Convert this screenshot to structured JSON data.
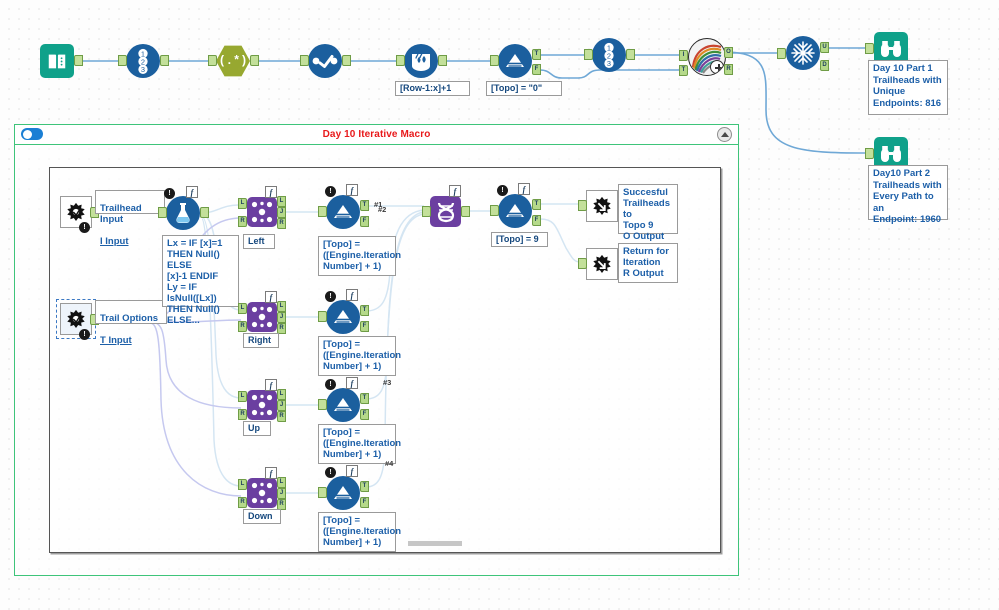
{
  "app": {
    "canvas_name": "Alteryx Workflow Canvas"
  },
  "macro": {
    "title": "Day 10 Iterative Macro",
    "toggle_icon": "toggle-on-icon",
    "collapse_icon": "collapse-up-icon"
  },
  "top_row": {
    "nodes": [
      {
        "id": "input-data",
        "icon": "input-data-icon",
        "label": ""
      },
      {
        "id": "record-id",
        "icon": "record-id-icon",
        "label": ""
      },
      {
        "id": "regex",
        "icon": "regex-icon",
        "label": ""
      },
      {
        "id": "select",
        "icon": "select-icon",
        "label": ""
      },
      {
        "id": "multi-row-formula",
        "icon": "multi-row-formula-icon",
        "label": "[Row-1:x]+1"
      },
      {
        "id": "filter",
        "icon": "filter-icon",
        "label": "[Topo] = \"0\""
      },
      {
        "id": "record-id-2",
        "icon": "record-id-icon",
        "label": ""
      },
      {
        "id": "iterative-macro",
        "icon": "iterative-macro-icon",
        "label": ""
      },
      {
        "id": "unique",
        "icon": "unique-icon",
        "label": ""
      },
      {
        "id": "browse-1",
        "icon": "browse-icon",
        "label": ""
      },
      {
        "id": "browse-2",
        "icon": "browse-icon",
        "label": ""
      }
    ],
    "annotations": {
      "part1": "Day 10 Part 1\nTrailheads with\nUnique\nEndpoints: 816",
      "part2": "Day10 Part 2\nTrailheads with\nEvery Path to an\nEndpoint: 1960"
    },
    "ports": {
      "filter_true": "T",
      "filter_false": "F",
      "macro_in_i": "I",
      "macro_in_t": "T",
      "macro_out_o": "O",
      "macro_out_r": "R",
      "unique_u": "U",
      "unique_d": "D"
    }
  },
  "macro_interior": {
    "inputs": [
      {
        "id": "trailhead-input",
        "name": "Trailhead Input",
        "sub": "I Input",
        "selected": false
      },
      {
        "id": "trail-options-input",
        "name": "Trail Options",
        "sub": "T Input",
        "selected": true
      }
    ],
    "formula": {
      "icon": "formula-icon",
      "text": "Lx = IF [x]=1\nTHEN Null() ELSE\n[x]-1 ENDIF\nLy = IF IsNull([Lx])\nTHEN Null()\nELSE..."
    },
    "branches": [
      {
        "id": "left",
        "join_label": "Left",
        "filter_text": "[Topo] =\n([Engine.Iteration\nNumber] + 1)",
        "wire_label": "#1"
      },
      {
        "id": "right",
        "join_label": "Right",
        "filter_text": "[Topo] =\n([Engine.Iteration\nNumber] + 1)",
        "wire_label": "#2"
      },
      {
        "id": "up",
        "join_label": "Up",
        "filter_text": "[Topo] =\n([Engine.Iteration\nNumber] + 1)",
        "wire_label": "#3"
      },
      {
        "id": "down",
        "join_label": "Down",
        "filter_text": "[Topo] =\n([Engine.Iteration\nNumber] + 1)",
        "wire_label": "#4"
      }
    ],
    "union": {
      "id": "union",
      "icon": "union-icon"
    },
    "final_filter": {
      "id": "final-filter",
      "icon": "filter-icon",
      "text": "[Topo] = 9"
    },
    "outputs": [
      {
        "id": "output-o",
        "icon": "macro-output-icon",
        "text": "Succesful\nTrailheads to\nTopo 9\nO Output"
      },
      {
        "id": "output-r",
        "icon": "macro-output-icon",
        "text": "Return for\nIteration\nR Output"
      }
    ],
    "join_ports": {
      "in_left": "L",
      "in_right": "R",
      "out_left": "L",
      "out_join": "J",
      "out_right": "R"
    },
    "filter_ports": {
      "true": "T",
      "false": "F"
    }
  },
  "colors": {
    "macro_border": "#3ec47a",
    "macro_title": "#e8191b",
    "wire": "#6fa8d6",
    "wire_dark": "#3b46c8",
    "tool_blue": "#1b5f9e",
    "tool_purple": "#6b3fa0",
    "tool_teal": "#0fa18a",
    "tool_olive": "#97a830",
    "port_green": "#b5d98a",
    "anno_text": "#1c5fa8"
  }
}
